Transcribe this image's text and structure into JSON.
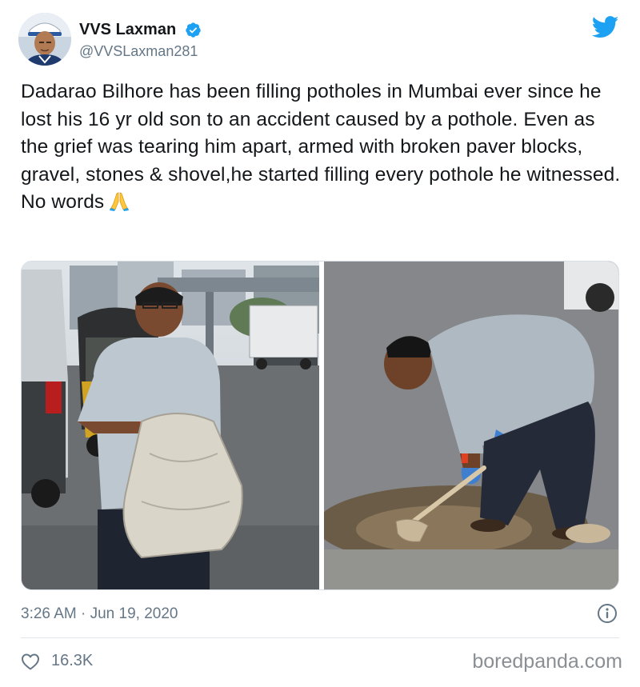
{
  "author": {
    "display_name": "VVS Laxman",
    "handle": "@VVSLaxman281",
    "verified": true,
    "avatar_icon": "profile-photo"
  },
  "brand": {
    "logo_icon": "twitter-bird-icon",
    "accent_color": "#1da1f2"
  },
  "tweet": {
    "text": "Dadarao Bilhore has been filling potholes in Mumbai ever since he lost his 16 yr old son to an accident caused by a pothole. Even as the grief was tearing him apart, armed with broken paver blocks, gravel, stones & shovel,he started filling every pothole he witnessed. No words",
    "emoji": "🙏",
    "timestamp": "3:26 AM · Jun 19, 2020",
    "likes": "16.3K"
  },
  "media": {
    "photos": [
      "man-holding-sack-of-gravel",
      "man-shoveling-pothole"
    ]
  },
  "watermark": "boredpanda.com"
}
